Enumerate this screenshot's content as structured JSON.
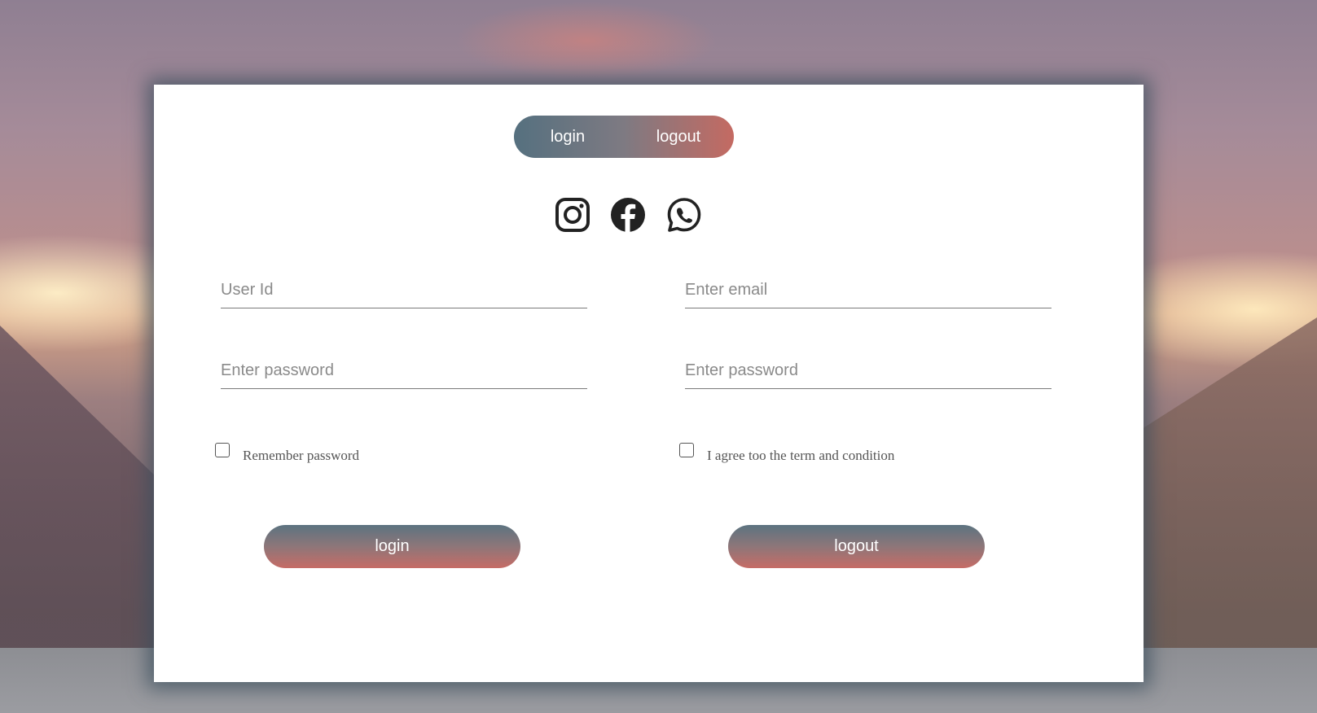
{
  "toggle": {
    "login_label": "login",
    "logout_label": "logout"
  },
  "socials": [
    {
      "icon": "instagram-icon"
    },
    {
      "icon": "facebook-icon"
    },
    {
      "icon": "whatsapp-icon"
    }
  ],
  "login_form": {
    "user_id_placeholder": "User Id",
    "password_placeholder": "Enter password",
    "remember_label": "Remember password",
    "remember_checked": false,
    "button_label": "login"
  },
  "logout_form": {
    "email_placeholder": "Enter email",
    "password_placeholder": "Enter password",
    "agree_label": "I agree too the term and condition",
    "agree_checked": false,
    "button_label": "logout"
  },
  "colors": {
    "gradient_start": "#55707f",
    "gradient_end": "#c46a62",
    "card_background": "#ffffff"
  }
}
